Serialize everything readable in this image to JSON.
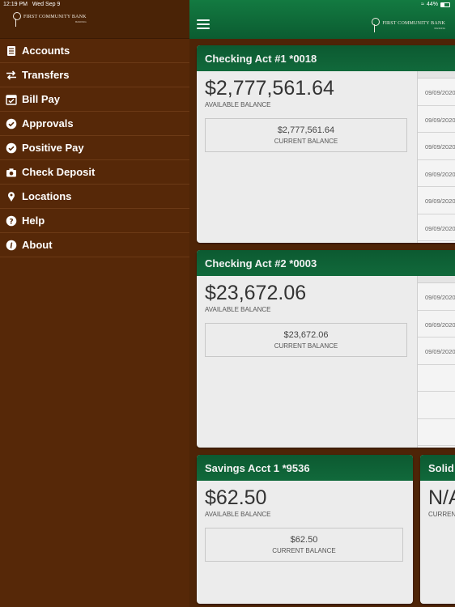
{
  "status": {
    "time": "12:19 PM",
    "date": "Wed Sep 9",
    "battery": "44%"
  },
  "brand": {
    "name": "FIRST COMMUNITY BANK",
    "sub": "BANKING"
  },
  "menu": [
    {
      "label": "Accounts",
      "icon": "accounts-icon"
    },
    {
      "label": "Transfers",
      "icon": "transfer-arrows-icon"
    },
    {
      "label": "Bill Pay",
      "icon": "calendar-check-icon"
    },
    {
      "label": "Approvals",
      "icon": "check-circle-icon"
    },
    {
      "label": "Positive Pay",
      "icon": "check-circle-icon"
    },
    {
      "label": "Check Deposit",
      "icon": "camera-icon"
    },
    {
      "label": "Locations",
      "icon": "map-pin-icon"
    },
    {
      "label": "Help",
      "icon": "question-circle-icon"
    },
    {
      "label": "About",
      "icon": "info-circle-icon"
    }
  ],
  "accounts": [
    {
      "name": "Checking Act #1 *0018",
      "available": "$2,777,561.64",
      "available_label": "AVAILABLE BALANCE",
      "current": "$2,777,561.64",
      "current_label": "CURRENT BALANCE",
      "tx_dates": [
        "09/09/2020",
        "09/09/2020",
        "09/09/2020",
        "09/09/2020",
        "09/09/2020",
        "09/09/2020"
      ]
    },
    {
      "name": "Checking Act #2 *0003",
      "available": "$23,672.06",
      "available_label": "AVAILABLE BALANCE",
      "current": "$23,672.06",
      "current_label": "CURRENT BALANCE",
      "tx_dates": [
        "09/09/2020",
        "09/09/2020",
        "09/09/2020",
        "",
        "",
        ""
      ]
    },
    {
      "name": "Savings Acct 1 *9536",
      "available": "$62.50",
      "available_label": "AVAILABLE BALANCE",
      "current": "$62.50",
      "current_label": "CURRENT BALANCE"
    },
    {
      "name": "Solid",
      "available": "N/A",
      "available_label": "CURREN"
    }
  ],
  "colors": {
    "header_green": "#0f6e3a",
    "sidebar_brown": "#562808",
    "background_brown": "#4e2407"
  }
}
